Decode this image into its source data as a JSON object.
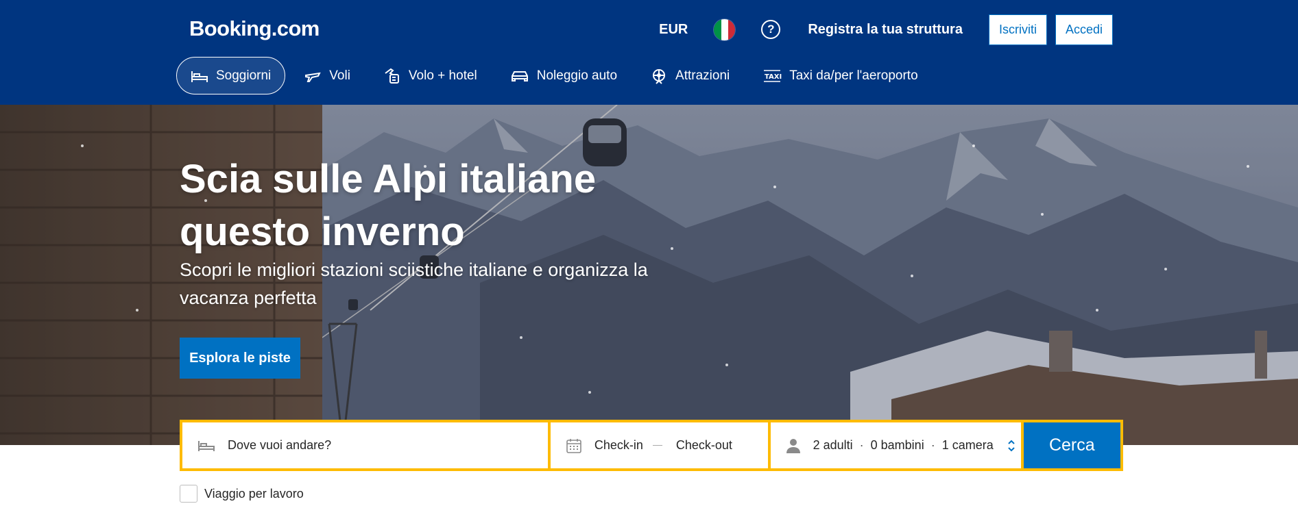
{
  "header": {
    "logo": "Booking.com",
    "currency": "EUR",
    "help_symbol": "?",
    "register_property": "Registra la tua struttura",
    "signup": "Iscriviti",
    "login": "Accedi",
    "flag_colors": [
      "#009246",
      "#ffffff",
      "#ce2b37"
    ],
    "nav": [
      {
        "label": "Soggiorni",
        "icon": "bed-icon",
        "active": true
      },
      {
        "label": "Voli",
        "icon": "plane-icon",
        "active": false
      },
      {
        "label": "Volo + hotel",
        "icon": "flight-hotel-icon",
        "active": false
      },
      {
        "label": "Noleggio auto",
        "icon": "car-icon",
        "active": false
      },
      {
        "label": "Attrazioni",
        "icon": "attraction-icon",
        "active": false
      },
      {
        "label": "Taxi da/per l'aeroporto",
        "icon": "taxi-icon",
        "active": false
      }
    ]
  },
  "hero": {
    "title": "Scia sulle Alpi italiane questo inverno",
    "subtitle": "Scopri le migliori stazioni sciistiche italiane e organizza la vacanza perfetta",
    "button": "Esplora le piste"
  },
  "search": {
    "destination_placeholder": "Dove vuoi andare?",
    "checkin": "Check-in",
    "checkout": "Check-out",
    "adults": "2 adulti",
    "children": "0 bambini",
    "rooms": "1 camera",
    "separator": "·",
    "submit": "Cerca",
    "work_trip": "Viaggio per lavoro",
    "work_trip_checked": false
  },
  "colors": {
    "brand_blue": "#003580",
    "action_blue": "#0071c2",
    "search_border": "#febb02"
  }
}
